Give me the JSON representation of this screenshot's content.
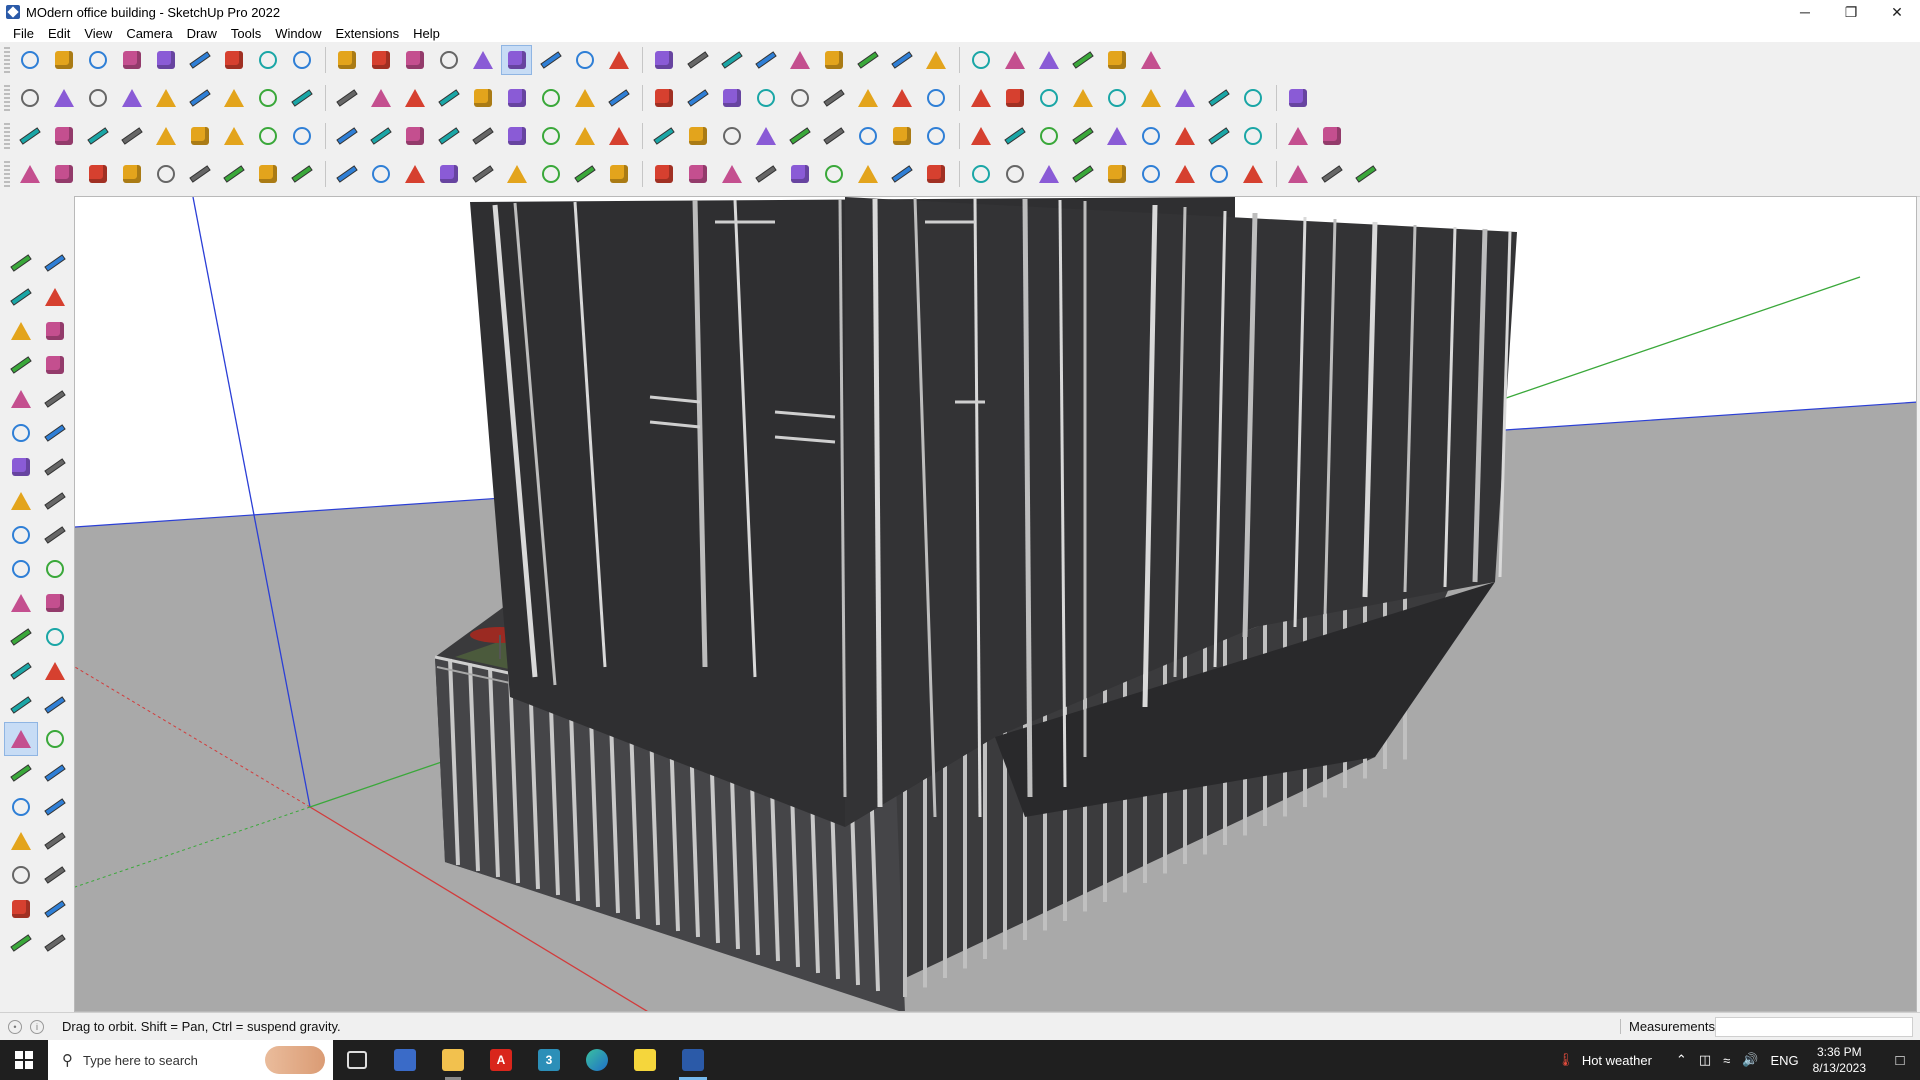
{
  "window": {
    "title": "MOdern office building - SketchUp Pro 2022",
    "controls": {
      "minimize": "─",
      "maximize": "❐",
      "close": "✕"
    }
  },
  "menu": [
    "File",
    "Edit",
    "View",
    "Camera",
    "Draw",
    "Tools",
    "Window",
    "Extensions",
    "Help"
  ],
  "toolbar_rows": [
    [
      "zoom-icon",
      "select-icon",
      "eraser-icon",
      "line-icon",
      "arc-icon",
      "rectangle-icon",
      "push-pull-icon",
      "follow-me-icon",
      "move-icon",
      "rotate-icon",
      "scale-icon",
      "tape-measure-icon",
      "text-icon",
      "paint-bucket-icon",
      "orbit-icon",
      "pan-icon",
      "zoom-icon",
      "zoom-extents-icon",
      "warehouse-icon",
      "extension-warehouse-icon",
      "layout-icon",
      "extension-manager-icon",
      "account-icon",
      "add-location-icon",
      "toggle-terrain-icon",
      "photo-texture-icon",
      "sandbox-icon",
      "stamp-icon",
      "drape-icon",
      "flip-icon",
      "undo-icon",
      "redo-icon",
      "dynamic-component-icon"
    ],
    [
      "iso-view-icon",
      "top-view-icon",
      "front-view-icon",
      "right-view-icon",
      "back-view-icon",
      "left-view-icon",
      "bottom-view-icon",
      "x-ray-icon",
      "back-edges-icon",
      "wireframe-icon",
      "hidden-line-icon",
      "shaded-icon",
      "shaded-texture-icon",
      "monochrome-icon",
      "house-icon",
      "house-icon",
      "house-icon",
      "style-icon",
      "section-plane-icon",
      "section-display-icon",
      "section-cut-icon",
      "polygon-icon",
      "circle-icon",
      "ellipse-icon",
      "parallelogram-icon",
      "star-icon",
      "spline-icon",
      "fillet-icon",
      "chamfer-icon",
      "extrude-icon",
      "outer-shell-icon",
      "intersect-icon",
      "union-icon",
      "subtract-icon",
      "trim-icon",
      "split-icon",
      "solid-tools-icon"
    ],
    [
      "layer-blue-icon",
      "layer-blue-icon",
      "layer-yellow-icon",
      "layer-green-icon",
      "layer-red-icon",
      "layer-gray-icon",
      "rotate-copy-icon",
      "frame-icon",
      "grid-icon",
      "shape-icon",
      "wood-icon",
      "pipe-icon",
      "corner-icon",
      "curve-icon",
      "cross-icon",
      "cross-icon",
      "cross-icon",
      "cone-icon",
      "cone-icon",
      "triangle-icon",
      "loop-icon",
      "loop-icon",
      "loop-icon",
      "sparkle-icon",
      "cube-icon",
      "magnet-icon",
      "plugin-icon",
      "plugin-icon",
      "plugin-icon",
      "gem-icon",
      "gear-icon",
      "window-icon",
      "grid-icon",
      "grid-icon",
      "grid-icon",
      "close-icon",
      "curve-icon",
      "layout-icon"
    ],
    [
      "line-edit-icon",
      "curve-edit-icon",
      "paint-icon",
      "scissors-icon",
      "gear-icon",
      "cloud-icon",
      "hand-icon",
      "cube-icon",
      "sphere-icon",
      "stair-icon",
      "corner-icon",
      "corner-icon",
      "cut-icon",
      "curve-icon",
      "box-icon",
      "prism-icon",
      "column-icon",
      "column-icon",
      "glove-icon",
      "leaf-icon",
      "arrow-icon",
      "stack-icon",
      "slash-icon",
      "slash-icon",
      "slash-icon",
      "slash-icon",
      "block-icon",
      "stair-icon",
      "door-icon",
      "door-icon",
      "grid-icon",
      "grid-icon",
      "grid-icon",
      "grid-icon",
      "circle-icon",
      "circle-icon",
      "slash-icon",
      "stack-icon",
      "cube-icon"
    ]
  ],
  "left_tools": [
    "select-icon",
    "orbit-icon",
    "paint-bucket-icon",
    "eraser-icon",
    "component-icon",
    "pencil-icon",
    "line-icon",
    "freehand-icon",
    "rectangle-icon",
    "rotated-rectangle-icon",
    "circle-icon",
    "polygon-icon",
    "arc-icon",
    "two-point-arc-icon",
    "pie-icon",
    "three-point-arc-icon",
    "move-icon",
    "push-pull-icon",
    "rotate-icon",
    "follow-me-icon",
    "scale-icon",
    "offset-icon",
    "tape-measure-icon",
    "dimension-icon",
    "protractor-icon",
    "text-icon",
    "axes-icon",
    "3d-text-icon",
    "orbit-icon",
    "pan-icon",
    "zoom-icon",
    "zoom-window-icon",
    "zoom-extents-icon",
    "previous-view-icon",
    "position-camera-icon",
    "look-around-icon",
    "walk-icon",
    "section-plane-icon",
    "warehouse-icon",
    "extension-warehouse-icon",
    "layers-icon",
    "extension-manager-icon"
  ],
  "status": {
    "hint": "Drag to orbit.  Shift = Pan, Ctrl = suspend gravity.",
    "measurements_label": "Measurements",
    "measurements_value": ""
  },
  "taskbar": {
    "search_placeholder": "Type here to search",
    "apps": [
      {
        "name": "task-view",
        "label": ""
      },
      {
        "name": "calculator",
        "label": ""
      },
      {
        "name": "file-explorer",
        "label": ""
      },
      {
        "name": "acrobat",
        "label": "A"
      },
      {
        "name": "sketchup-3",
        "label": "3"
      },
      {
        "name": "edge",
        "label": ""
      },
      {
        "name": "sticky-notes",
        "label": ""
      },
      {
        "name": "sketchup",
        "label": ""
      }
    ],
    "weather": "Hot weather",
    "language": "ENG",
    "time": "3:36 PM",
    "date": "8/13/2023"
  },
  "colors": {
    "ground": "#a9a9a9",
    "sky": "#ffffff",
    "building_dark": "#2f2f31",
    "fin_light": "#cfcfcf",
    "axis_red": "#d23b3b",
    "axis_green": "#3aa83a",
    "axis_blue": "#2b3fd6",
    "roof_grass": "#4b5a3c"
  }
}
